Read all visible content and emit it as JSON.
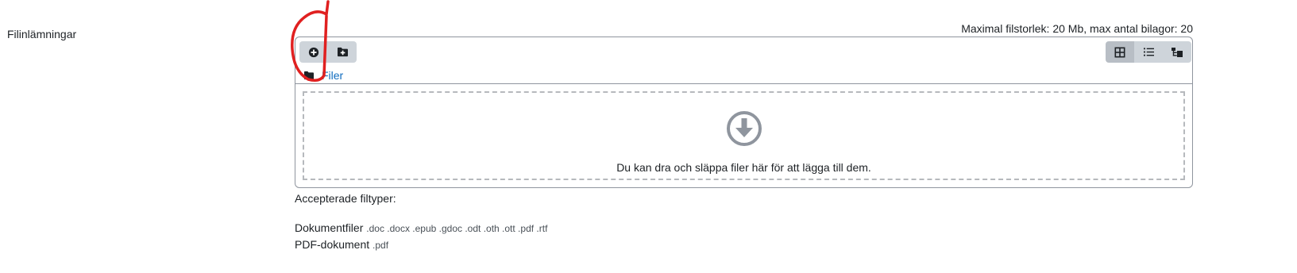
{
  "form": {
    "label": "Filinlämningar",
    "max_info": "Maximal filstorlek: 20 Mb, max antal bilagor: 20"
  },
  "toolbar": {
    "add_file_icon": "plus-circle-icon",
    "create_folder_icon": "folder-plus-icon",
    "view_buttons": [
      {
        "icon": "grid-icon",
        "active": true
      },
      {
        "icon": "list-icon",
        "active": false
      },
      {
        "icon": "tree-icon",
        "active": false
      }
    ]
  },
  "path": {
    "folder_icon": "folder-icon",
    "label": "Filer"
  },
  "dropzone": {
    "icon": "arrow-down-circle-icon",
    "text": "Du kan dra och släppa filer här för att lägga till dem."
  },
  "accepted": {
    "title": "Accepterade filtyper:",
    "types": [
      {
        "name": "Dokumentfiler",
        "extensions": ".doc .docx .epub .gdoc .odt .oth .ott .pdf .rtf"
      },
      {
        "name": "PDF-dokument",
        "extensions": ".pdf"
      }
    ]
  },
  "colors": {
    "link": "#0f6cbf",
    "button_bg": "#ced4da",
    "active_button_bg": "#b8bec5",
    "border": "#8f959e",
    "annotation": "#e02020"
  }
}
